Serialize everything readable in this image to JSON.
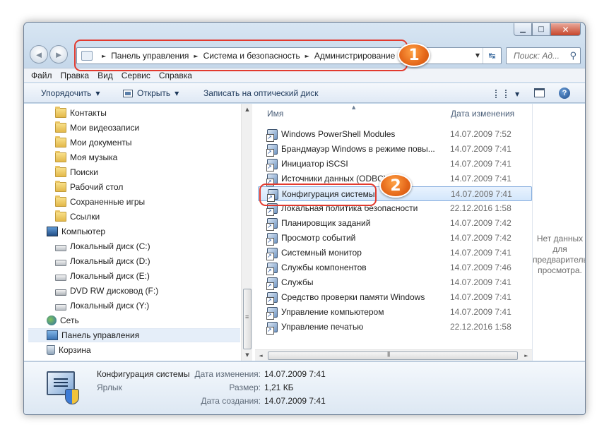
{
  "window": {
    "caption_buttons": {
      "minimize": "▁",
      "maximize": "□",
      "close": "✕"
    },
    "nav": {
      "back_icon": "left-arrow-icon",
      "forward_icon": "right-arrow-icon",
      "back": "◄",
      "forward": "►"
    },
    "address": {
      "breadcrumbs": [
        "Панель управления",
        "Система и безопасность",
        "Администрирование"
      ],
      "separator": "►",
      "dropdown": "▼",
      "refresh": "↹"
    },
    "search": {
      "placeholder": "Поиск: Ад...",
      "icon": "⚲"
    },
    "menu": [
      "Файл",
      "Правка",
      "Вид",
      "Сервис",
      "Справка"
    ],
    "toolbar": {
      "organize": "Упорядочить",
      "open": "Открыть",
      "burn": "Записать на оптический диск",
      "arrow": "▼",
      "help": "?"
    },
    "tree": [
      {
        "label": "Контакты",
        "icon": "folder-icon",
        "kind": "folder"
      },
      {
        "label": "Мои видеозаписи",
        "icon": "folder-icon",
        "kind": "folder"
      },
      {
        "label": "Мои документы",
        "icon": "folder-icon",
        "kind": "folder"
      },
      {
        "label": "Моя музыка",
        "icon": "folder-icon",
        "kind": "folder"
      },
      {
        "label": "Поиски",
        "icon": "folder-icon",
        "kind": "folder"
      },
      {
        "label": "Рабочий стол",
        "icon": "folder-icon",
        "kind": "folder"
      },
      {
        "label": "Сохраненные игры",
        "icon": "folder-icon",
        "kind": "folder"
      },
      {
        "label": "Ссылки",
        "icon": "folder-icon",
        "kind": "folder"
      },
      {
        "label": "Компьютер",
        "icon": "computer-icon",
        "kind": "computer"
      },
      {
        "label": "Локальный диск (C:)",
        "icon": "drive-icon",
        "kind": "drive"
      },
      {
        "label": "Локальный диск (D:)",
        "icon": "drive-icon",
        "kind": "drive"
      },
      {
        "label": "Локальный диск (E:)",
        "icon": "drive-icon",
        "kind": "drive"
      },
      {
        "label": "DVD RW дисковод (F:)",
        "icon": "dvd-icon",
        "kind": "dvd"
      },
      {
        "label": "Локальный диск (Y:)",
        "icon": "drive-icon",
        "kind": "drive"
      },
      {
        "label": "Сеть",
        "icon": "network-icon",
        "kind": "network"
      },
      {
        "label": "Панель управления",
        "icon": "control-panel-icon",
        "kind": "cpanel",
        "selected": true
      },
      {
        "label": "Корзина",
        "icon": "recycle-bin-icon",
        "kind": "bin"
      }
    ],
    "columns": {
      "name": "Имя",
      "date": "Дата изменения",
      "sort_arrow": "▲"
    },
    "files": [
      {
        "name": "Windows PowerShell Modules",
        "date": "14.07.2009 7:52"
      },
      {
        "name": "Брандмауэр Windows в режиме повы...",
        "date": "14.07.2009 7:41"
      },
      {
        "name": "Инициатор iSCSI",
        "date": "14.07.2009 7:41"
      },
      {
        "name": "Источники данных (ODBC)",
        "date": "14.07.2009 7:41"
      },
      {
        "name": "Конфигурация системы",
        "date": "14.07.2009 7:41",
        "selected": true
      },
      {
        "name": "Локальная политика безопасности",
        "date": "22.12.2016 1:58"
      },
      {
        "name": "Планировщик заданий",
        "date": "14.07.2009 7:42"
      },
      {
        "name": "Просмотр событий",
        "date": "14.07.2009 7:42"
      },
      {
        "name": "Системный монитор",
        "date": "14.07.2009 7:41"
      },
      {
        "name": "Службы компонентов",
        "date": "14.07.2009 7:46"
      },
      {
        "name": "Службы",
        "date": "14.07.2009 7:41"
      },
      {
        "name": "Средство проверки памяти Windows",
        "date": "14.07.2009 7:41"
      },
      {
        "name": "Управление компьютером",
        "date": "14.07.2009 7:41"
      },
      {
        "name": "Управление печатью",
        "date": "22.12.2016 1:58"
      }
    ],
    "preview": {
      "text": "Нет данных для предварительного просмотра."
    },
    "scroll": {
      "up": "▲",
      "down": "▼",
      "left": "◄",
      "right": "►"
    },
    "details": {
      "title": "Конфигурация системы",
      "type": "Ярлык",
      "modified_label": "Дата изменения:",
      "modified_value": "14.07.2009 7:41",
      "size_label": "Размер:",
      "size_value": "1,21 КБ",
      "created_label": "Дата создания:",
      "created_value": "14.07.2009 7:41"
    }
  },
  "annotations": {
    "badge1": "1",
    "badge2": "2",
    "color": "#e5681a",
    "outline_color": "#e23a2e"
  }
}
